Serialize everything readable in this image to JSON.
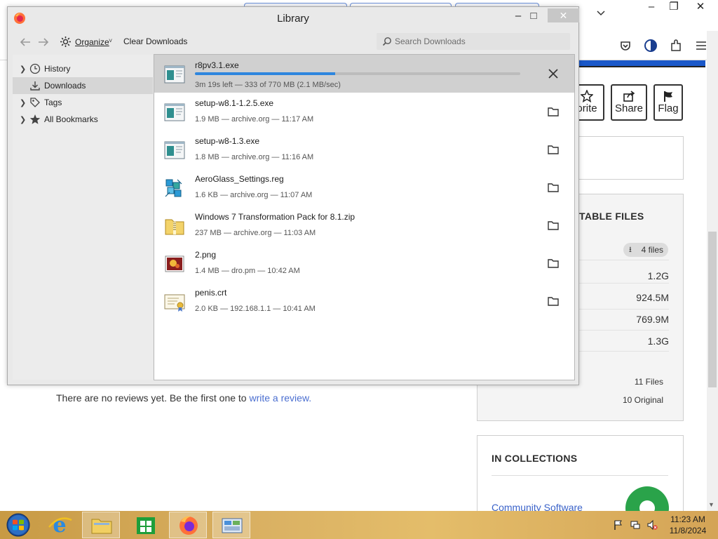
{
  "background": {
    "buttons": [
      {
        "label": "orite",
        "icon": "star-icon"
      },
      {
        "label": "Share",
        "icon": "share-icon"
      },
      {
        "label": "Flag",
        "icon": "flag-icon"
      }
    ],
    "files_heading": "TABLE FILES",
    "files_badge": "4 files",
    "sizes": [
      "1.2G",
      "924.5M",
      "769.9M",
      "1.3G"
    ],
    "file_count": "11 Files",
    "original_count": "10 Original",
    "reviews_text": "There are no reviews yet. Be the first one to ",
    "reviews_link": "write a review.",
    "collections_heading": "IN COLLECTIONS",
    "collection_link": "Community Software"
  },
  "library": {
    "title": "Library",
    "toolbar": {
      "organize": "Organize",
      "clear_downloads": "Clear Downloads",
      "search_placeholder": "Search Downloads"
    },
    "sidebar": [
      {
        "label": "History",
        "icon": "clock-icon",
        "selected": false
      },
      {
        "label": "Downloads",
        "icon": "download-icon",
        "selected": true
      },
      {
        "label": "Tags",
        "icon": "tag-icon",
        "selected": false
      },
      {
        "label": "All Bookmarks",
        "icon": "star-icon",
        "selected": false
      }
    ],
    "downloads": [
      {
        "name": "r8pv3.1.exe",
        "meta": "3m 19s left — 333 of 770 MB (2.1 MB/sec)",
        "icon": "exe-icon",
        "progress": 0.43,
        "active": true,
        "action": "cancel-icon"
      },
      {
        "name": "setup-w8.1-1.2.5.exe",
        "meta": "1.9 MB — archive.org — 11:17 AM",
        "icon": "exe-icon",
        "action": "folder-icon"
      },
      {
        "name": "setup-w8-1.3.exe",
        "meta": "1.8 MB — archive.org — 11:16 AM",
        "icon": "exe-icon",
        "action": "folder-icon"
      },
      {
        "name": "AeroGlass_Settings.reg",
        "meta": "1.6 KB — archive.org — 11:07 AM",
        "icon": "registry-icon",
        "action": "folder-icon"
      },
      {
        "name": "Windows 7 Transformation Pack for 8.1.zip",
        "meta": "237 MB — archive.org — 11:03 AM",
        "icon": "zip-folder-icon",
        "action": "folder-icon"
      },
      {
        "name": "2.png",
        "meta": "1.4 MB — dro.pm — 10:42 AM",
        "icon": "image-icon",
        "action": "folder-icon"
      },
      {
        "name": "penis.crt",
        "meta": "2.0 KB — 192.168.1.1 — 10:41 AM",
        "icon": "certificate-icon",
        "action": "folder-icon"
      }
    ]
  },
  "taskbar": {
    "time": "11:23 AM",
    "date": "11/8/2024"
  },
  "colors": {
    "progress": "#2e86de",
    "active_row": "#d0d0d0",
    "taskbar": "#d9b062",
    "link": "#4b6fd0"
  }
}
